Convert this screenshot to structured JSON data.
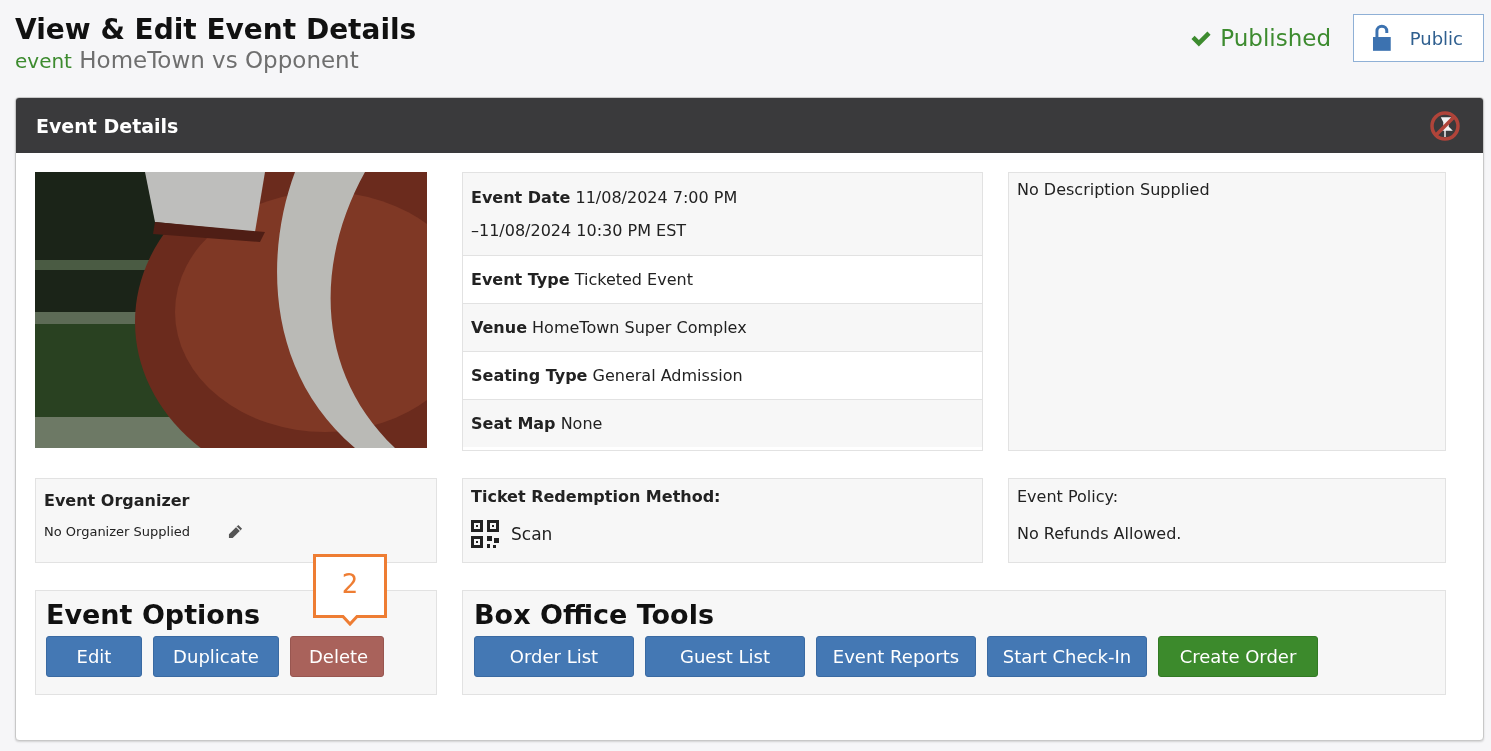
{
  "header": {
    "title": "View & Edit Event Details",
    "subtitle_tag": "event",
    "subtitle": "HomeTown vs Opponent",
    "status": "Published",
    "visibility_button": "Public"
  },
  "panel": {
    "title": "Event Details",
    "details": [
      {
        "label": "Event Date",
        "value": "11/08/2024 7:00 PM –11/08/2024 10:30 PM EST"
      },
      {
        "label": "Event Type",
        "value": "Ticketed Event"
      },
      {
        "label": "Venue",
        "value": "HomeTown Super Complex"
      },
      {
        "label": "Seating Type",
        "value": "General Admission"
      },
      {
        "label": "Seat Map",
        "value": "None"
      }
    ],
    "description": "No Description Supplied",
    "organizer": {
      "title": "Event Organizer",
      "value": "No Organizer Supplied"
    },
    "redemption": {
      "title": "Ticket Redemption Method:",
      "value": "Scan"
    },
    "policy": {
      "title": "Event Policy:",
      "value": "No Refunds Allowed."
    },
    "event_options": {
      "title": "Event Options",
      "buttons": [
        {
          "label": "Edit",
          "kind": "primary"
        },
        {
          "label": "Duplicate",
          "kind": "primary"
        },
        {
          "label": "Delete",
          "kind": "danger"
        }
      ],
      "callout": "2"
    },
    "box_office": {
      "title": "Box Office Tools",
      "buttons": [
        {
          "label": "Order List",
          "kind": "primary"
        },
        {
          "label": "Guest List",
          "kind": "primary"
        },
        {
          "label": "Event Reports",
          "kind": "primary"
        },
        {
          "label": "Start Check-In",
          "kind": "primary"
        },
        {
          "label": "Create Order",
          "kind": "success"
        }
      ]
    }
  }
}
